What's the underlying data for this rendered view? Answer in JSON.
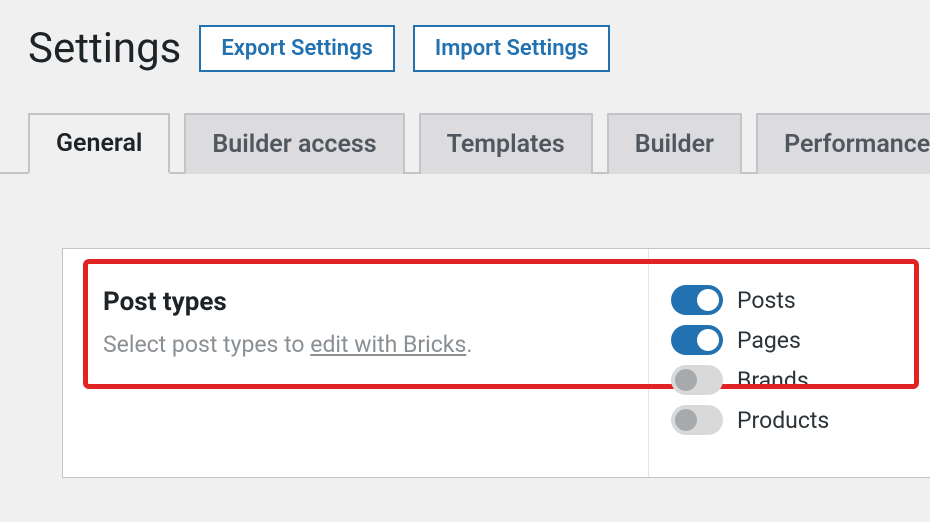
{
  "header": {
    "title": "Settings",
    "export_btn": "Export Settings",
    "import_btn": "Import Settings"
  },
  "tabs": {
    "items": [
      {
        "label": "General",
        "active": true
      },
      {
        "label": "Builder access",
        "active": false
      },
      {
        "label": "Templates",
        "active": false
      },
      {
        "label": "Builder",
        "active": false
      },
      {
        "label": "Performance",
        "active": false
      }
    ]
  },
  "section": {
    "title": "Post types",
    "desc_prefix": "Select post types to ",
    "desc_link": "edit with Bricks",
    "desc_suffix": "."
  },
  "post_types": [
    {
      "label": "Posts",
      "enabled": true
    },
    {
      "label": "Pages",
      "enabled": true
    },
    {
      "label": "Brands",
      "enabled": false
    },
    {
      "label": "Products",
      "enabled": false
    }
  ]
}
